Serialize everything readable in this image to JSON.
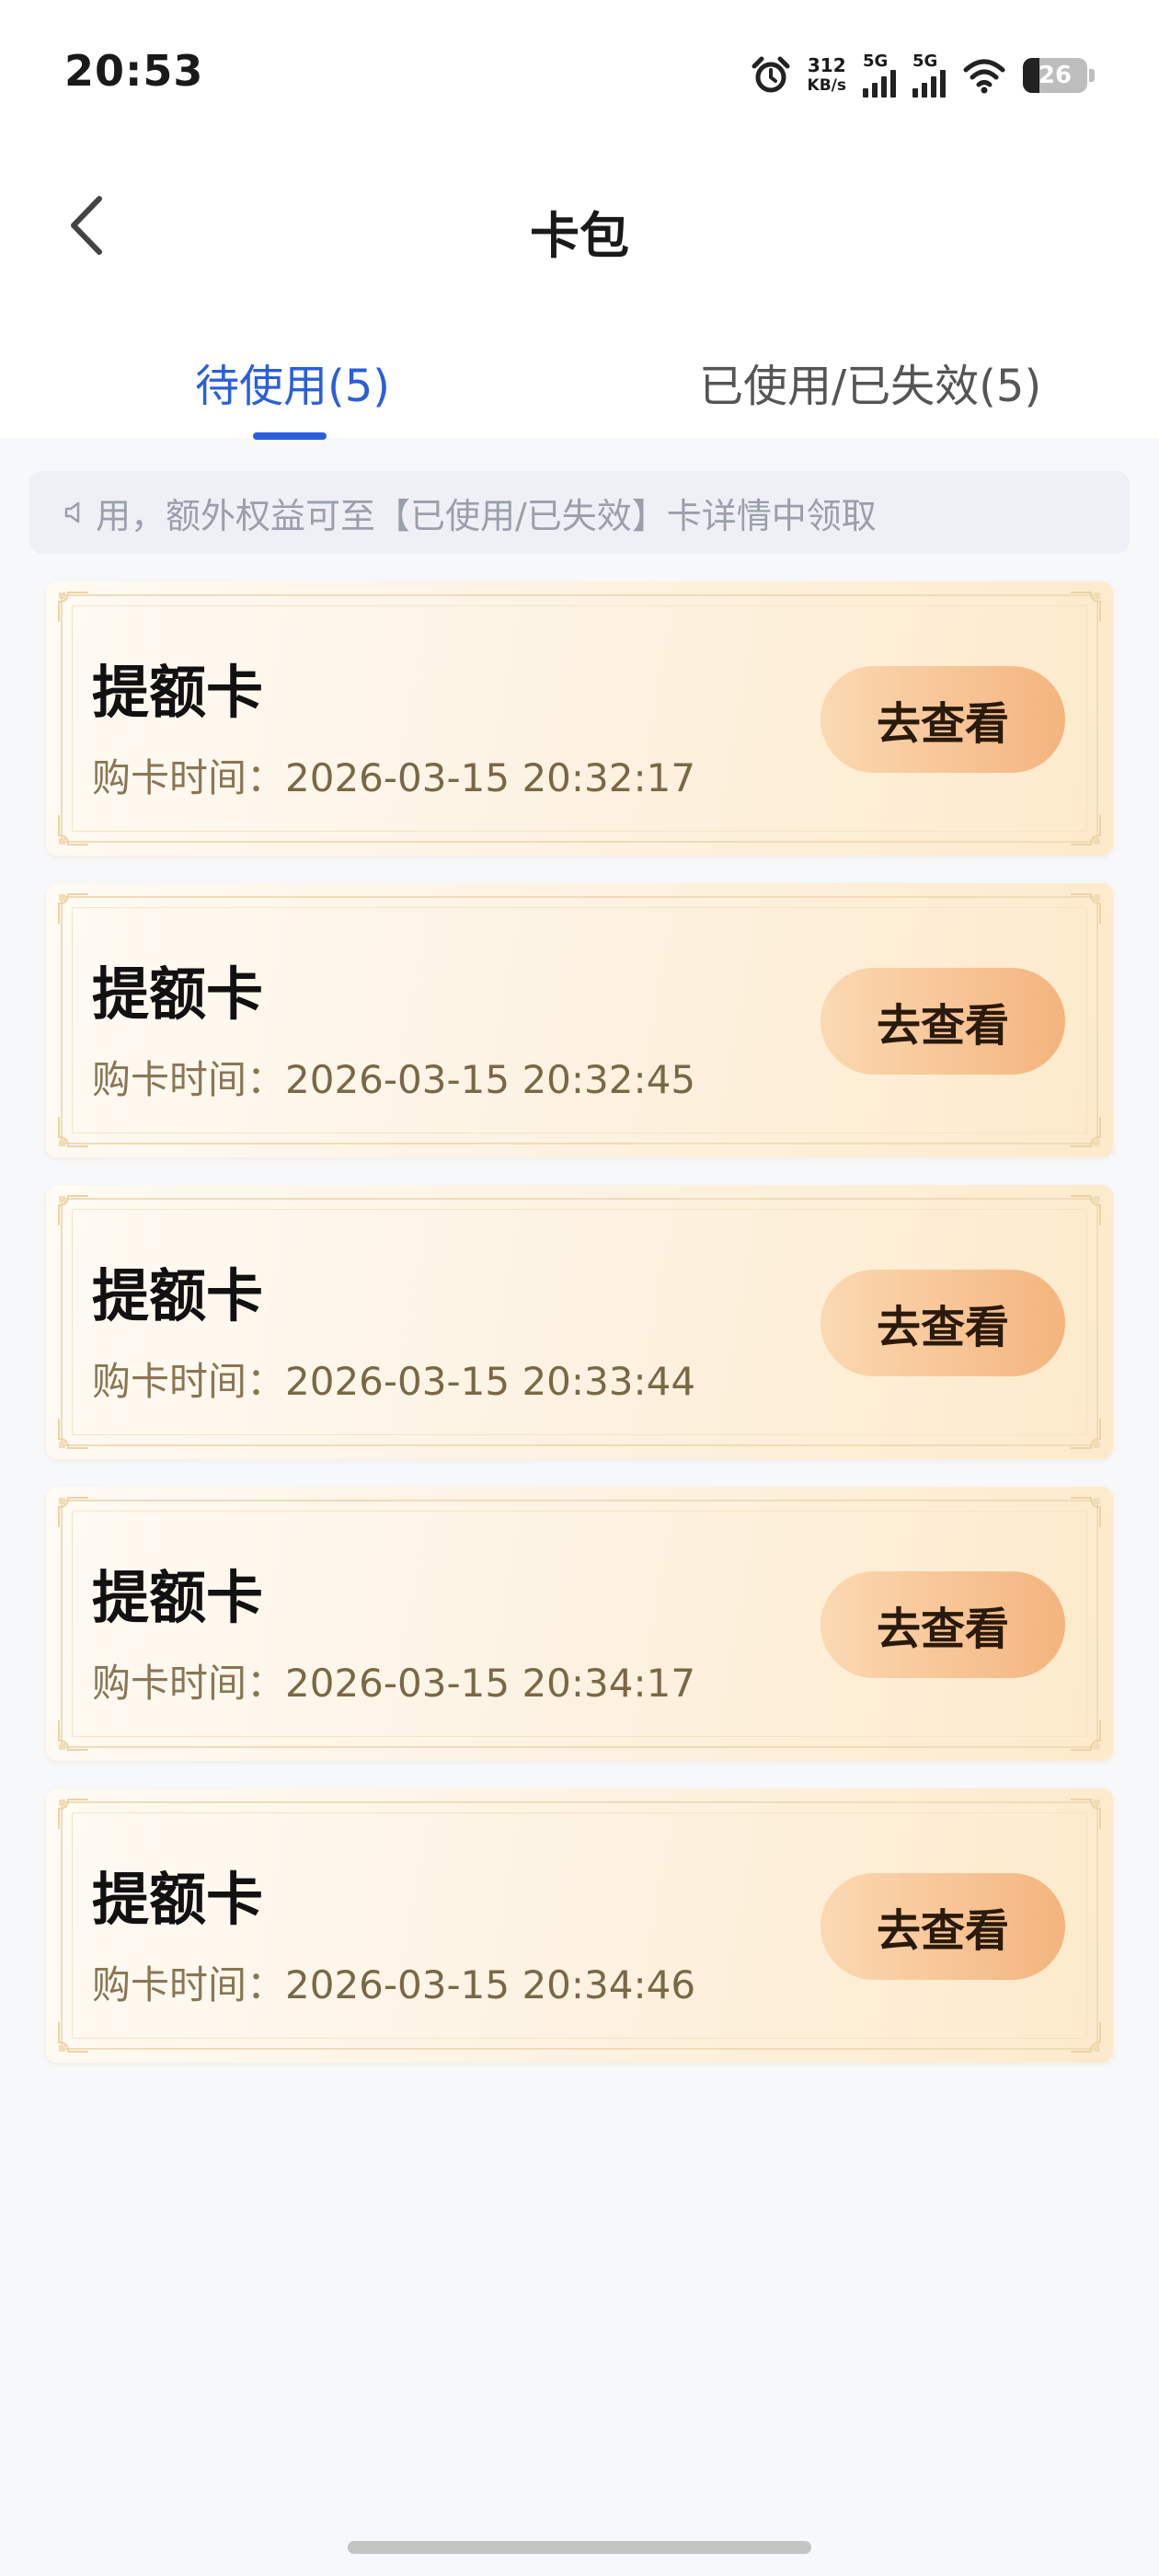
{
  "status_bar": {
    "time": "20:53",
    "net_speed_value": "312",
    "net_speed_unit": "KB/s",
    "sim1": "5G",
    "sim2": "5G",
    "battery": "26",
    "battery_level": 0.26,
    "icons": [
      "alarm-icon",
      "signal-icon",
      "wifi-icon",
      "battery-icon"
    ]
  },
  "header": {
    "title": "卡包",
    "back_icon": "chevron-left-icon"
  },
  "tabs": [
    {
      "label": "待使用(5)",
      "active": true
    },
    {
      "label": "已使用/已失效(5)",
      "active": false
    }
  ],
  "notice": {
    "icon": "speaker-icon",
    "text": "用，额外权益可至【已使用/已失效】卡详情中领取"
  },
  "cards": [
    {
      "title": "提额卡",
      "time_label": "购卡时间：",
      "time_value": "2026-03-15 20:32:17",
      "button": "去查看"
    },
    {
      "title": "提额卡",
      "time_label": "购卡时间：",
      "time_value": "2026-03-15 20:32:45",
      "button": "去查看"
    },
    {
      "title": "提额卡",
      "time_label": "购卡时间：",
      "time_value": "2026-03-15 20:33:44",
      "button": "去查看"
    },
    {
      "title": "提额卡",
      "time_label": "购卡时间：",
      "time_value": "2026-03-15 20:34:17",
      "button": "去查看"
    },
    {
      "title": "提额卡",
      "time_label": "购卡时间：",
      "time_value": "2026-03-15 20:34:46",
      "button": "去查看"
    }
  ],
  "colors": {
    "accent": "#2b5fd9",
    "button_start": "#fbd9b2",
    "button_end": "#f4b47e",
    "time_text": "#7a6845"
  }
}
